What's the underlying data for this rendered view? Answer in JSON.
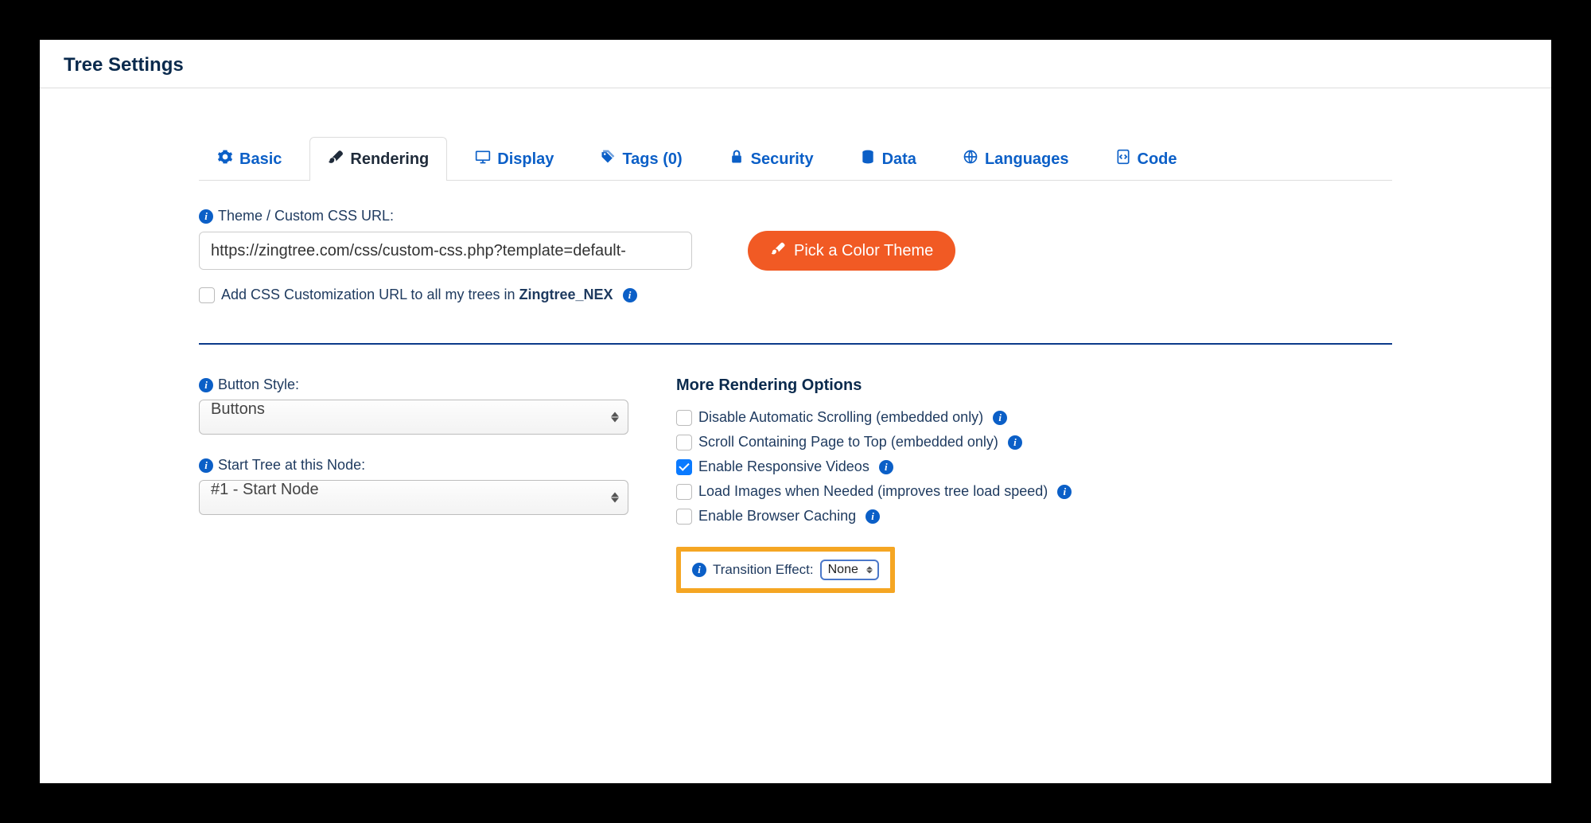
{
  "header": {
    "title": "Tree Settings"
  },
  "tabs": {
    "basic": "Basic",
    "rendering": "Rendering",
    "display": "Display",
    "tags": "Tags (0)",
    "security": "Security",
    "data": "Data",
    "languages": "Languages",
    "code": "Code"
  },
  "theme": {
    "label": "Theme / Custom CSS URL:",
    "url_value": "https://zingtree.com/css/custom-css.php?template=default-",
    "pick_button": "Pick a Color Theme",
    "apply_all_prefix": "Add CSS Customization URL to all my trees in ",
    "apply_all_org": "Zingtree_NEX"
  },
  "button_style": {
    "label": "Button Style:",
    "value": "Buttons"
  },
  "start_node": {
    "label": "Start Tree at this Node:",
    "value": "#1 - Start Node"
  },
  "more_options": {
    "heading": "More Rendering Options",
    "disable_scroll": "Disable Automatic Scrolling (embedded only)",
    "scroll_top": "Scroll Containing Page to Top (embedded only)",
    "responsive_videos": "Enable Responsive Videos",
    "lazy_images": "Load Images when Needed (improves tree load speed)",
    "browser_caching": "Enable Browser Caching",
    "transition_label": "Transition Effect:",
    "transition_value": "None"
  }
}
